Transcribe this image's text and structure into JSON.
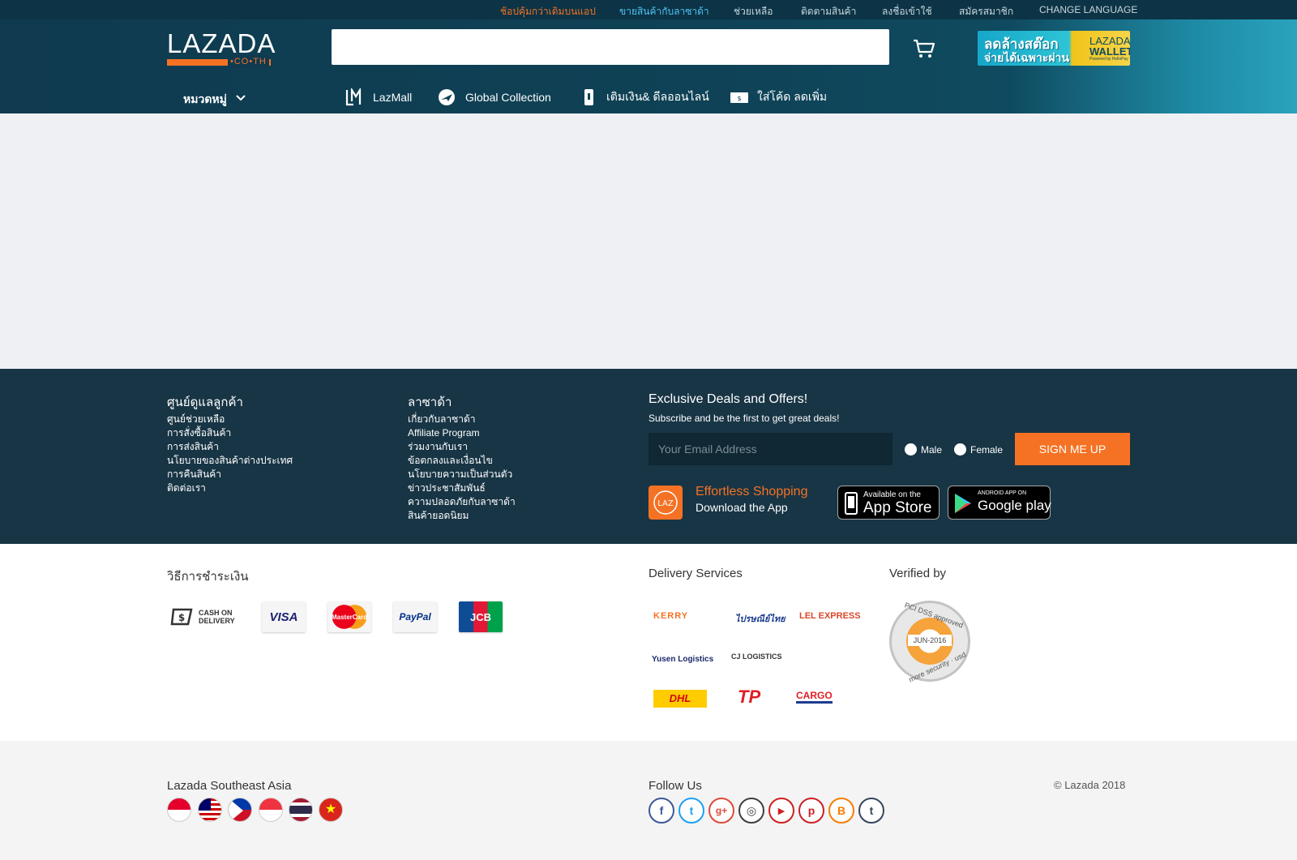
{
  "topbar": {
    "links": [
      {
        "label": "ช้อปคุ้มกว่าเดิมบนแอป",
        "color": "orange"
      },
      {
        "label": "ขายสินค้ากับลาซาด้า",
        "color": "blue"
      },
      {
        "label": "ช่วยเหลือ",
        "color": "normal"
      },
      {
        "label": "ติดตามสินค้า",
        "color": "normal"
      },
      {
        "label": "ลงชื่อเข้าใช้",
        "color": "normal"
      },
      {
        "label": "สมัครสมาชิก",
        "color": "normal"
      },
      {
        "label": "CHANGE LANGUAGE",
        "color": "normal"
      }
    ]
  },
  "logo": {
    "word": "LAZADA",
    "suffix": "•CO•TH"
  },
  "search": {
    "placeholder": ""
  },
  "banner": {
    "line1": "ลดล้างสต๊อก",
    "line2": "จ่ายได้เฉพาะผ่าน",
    "brand1": "LAZADA",
    "brand2": "WALLET",
    "brand3": "Powered by HelloPay"
  },
  "nav": {
    "category_label": "หมวดหมู่",
    "items": [
      {
        "label": "LazMall",
        "icon": "lazmall-icon"
      },
      {
        "label": "Global Collection",
        "icon": "global-collection-icon"
      },
      {
        "label": "เติมเงิน& ดีลออนไลน์",
        "icon": "mobile-topup-icon"
      },
      {
        "label": "ใส่โค้ด ลดเพิ่ม",
        "icon": "voucher-icon"
      }
    ]
  },
  "footer": {
    "customer_care": {
      "title": "ศูนย์ดูแลลูกค้า",
      "links": [
        "ศูนย์ช่วยเหลือ",
        "การสั่งซื้อสินค้า",
        "การส่งสินค้า",
        "นโยบายของสินค้าต่างประเทศ",
        "การคืนสินค้า",
        "ติดต่อเรา"
      ]
    },
    "lazada": {
      "title": "ลาซาด้า",
      "links": [
        "เกี่ยวกับลาซาด้า",
        "Affiliate Program",
        "ร่วมงานกับเรา",
        "ข้อตกลงและเงื่อนไข",
        "นโยบายความเป็นส่วนตัว",
        "ข่าวประชาสัมพันธ์",
        "ความปลอดภัยกับลาซาด้า",
        "สินค้ายอดนิยม"
      ]
    },
    "newsletter": {
      "title": "Exclusive Deals and Offers!",
      "subtitle": "Subscribe and be the first to get great deals!",
      "email_placeholder": "Your Email Address",
      "male": "Male",
      "female": "Female",
      "button": "SIGN ME UP"
    },
    "app": {
      "line1": "Effortless Shopping",
      "line2": "Download the App",
      "appstore_small": "Available on the",
      "appstore_large": "App Store",
      "googleplay_small": "ANDROID APP ON",
      "googleplay_large": "Google play",
      "icon_text": "LAZ"
    },
    "payment": {
      "title": "วิธีการชำระเงิน",
      "cod": "CASH ON DELIVERY",
      "methods": [
        "VISA",
        "MasterCard",
        "PayPal",
        "JCB"
      ]
    },
    "delivery": {
      "title": "Delivery Services",
      "partners": [
        "KERRY",
        "ไปรษณีย์ไทย",
        "LEL EXPRESS",
        "Yusen Logistics",
        "CJ LOGISTICS",
        "DHL",
        "TP",
        "CARGO"
      ]
    },
    "verified": {
      "title": "Verified by",
      "top": "PCI DSS approved",
      "date": "JUN-2016",
      "bottom": "more security · usd"
    },
    "bottom": {
      "region_title": "Lazada Southeast Asia",
      "follow_title": "Follow Us",
      "copyright": "© Lazada 2018",
      "social": [
        {
          "name": "facebook-icon",
          "glyph": "f",
          "color": "#3b5998"
        },
        {
          "name": "twitter-icon",
          "glyph": "t",
          "color": "#1da1f2"
        },
        {
          "name": "google-plus-icon",
          "glyph": "g+",
          "color": "#dd4b39"
        },
        {
          "name": "instagram-icon",
          "glyph": "◎",
          "color": "#3f3f3f"
        },
        {
          "name": "youtube-icon",
          "glyph": "▶",
          "color": "#cd201f"
        },
        {
          "name": "pinterest-icon",
          "glyph": "p",
          "color": "#cb2027"
        },
        {
          "name": "blogger-icon",
          "glyph": "B",
          "color": "#f57d00"
        },
        {
          "name": "tumblr-icon",
          "glyph": "t",
          "color": "#35465c"
        }
      ]
    }
  },
  "colors": {
    "accent": "#f57224",
    "header": "#0f3a4f",
    "footer": "#183545"
  }
}
